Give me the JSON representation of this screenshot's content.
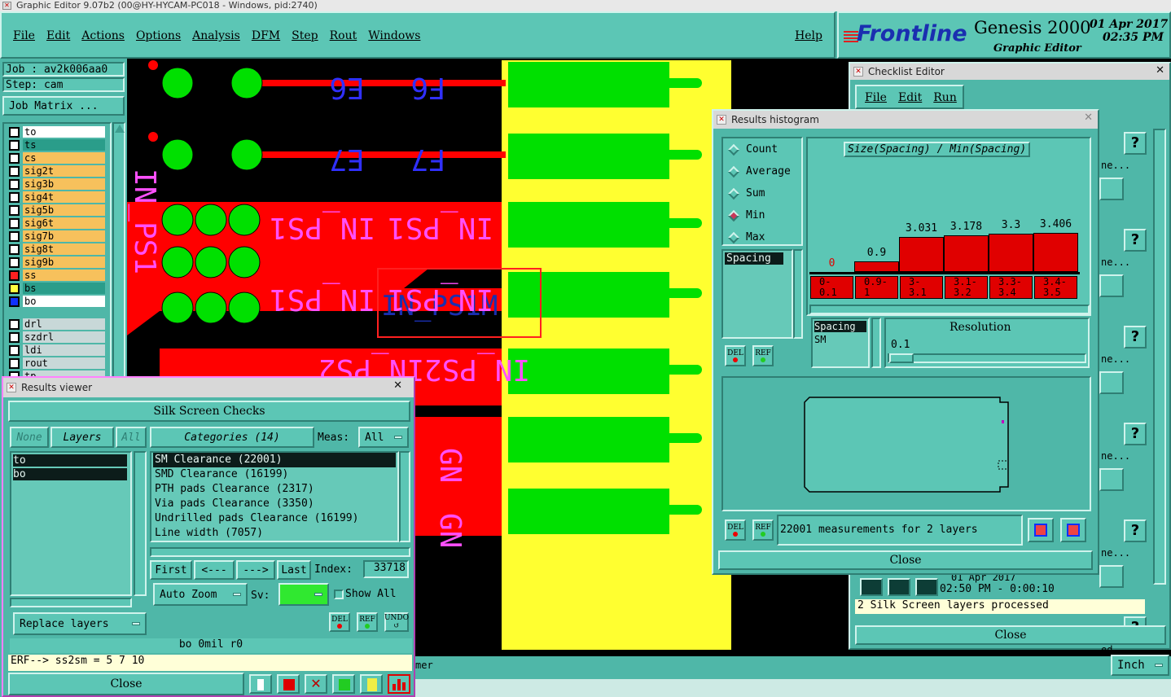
{
  "window": {
    "title": "Graphic Editor 9.07b2 (00@HY-HYCAM-PC018 - Windows, pid:2740)"
  },
  "menu": [
    "File",
    "Edit",
    "Actions",
    "Options",
    "Analysis",
    "DFM",
    "Step",
    "Rout",
    "Windows"
  ],
  "help": "Help",
  "brand": {
    "logo": "Frontline",
    "product": "Genesis 2000",
    "subtitle": "Graphic Editor",
    "date": "01 Apr 2017",
    "time": "02:35 PM"
  },
  "job": {
    "job_label": "Job : av2k006aa0",
    "step_label": "Step: cam",
    "matrix_button": "Job Matrix ..."
  },
  "layers": [
    {
      "name": "to",
      "color": "#ffffff",
      "box": "#ffffff"
    },
    {
      "name": "ts",
      "color": "#2a9d8a",
      "box": "#ffffff"
    },
    {
      "name": "cs",
      "color": "#f7c15c",
      "box": "#ffffff"
    },
    {
      "name": "sig2t",
      "color": "#f7c15c",
      "box": "#ffffff"
    },
    {
      "name": "sig3b",
      "color": "#f7c15c",
      "box": "#ffffff"
    },
    {
      "name": "sig4t",
      "color": "#f7c15c",
      "box": "#ffffff"
    },
    {
      "name": "sig5b",
      "color": "#f7c15c",
      "box": "#ffffff"
    },
    {
      "name": "sig6t",
      "color": "#f7c15c",
      "box": "#ffffff"
    },
    {
      "name": "sig7b",
      "color": "#f7c15c",
      "box": "#ffffff"
    },
    {
      "name": "sig8t",
      "color": "#f7c15c",
      "box": "#ffffff"
    },
    {
      "name": "sig9b",
      "color": "#f7c15c",
      "box": "#ffffff"
    },
    {
      "name": "ss",
      "color": "#f7c15c",
      "box": "#ff2020"
    },
    {
      "name": "bs",
      "color": "#2a9d8a",
      "box": "#ffff40"
    },
    {
      "name": "bo",
      "color": "#ffffff",
      "box": "#1030ff"
    }
  ],
  "layers2": [
    {
      "name": "drl",
      "color": "#c8d8d8"
    },
    {
      "name": "szdrl",
      "color": "#c8d8d8"
    },
    {
      "name": "ldi",
      "color": "#c8d8d8"
    },
    {
      "name": "rout",
      "color": "#c8d8d8"
    },
    {
      "name": "tp",
      "color": "#c8d8d8"
    }
  ],
  "board": {
    "labels_top": [
      "E6",
      "F6",
      "E7",
      "F7"
    ],
    "labels_net": [
      "IN_PS1",
      "IN_PS1",
      "IN_PS1",
      "IN_PS1",
      "IN_PS1",
      "IN_PS1M",
      "IN_PS2",
      "IN_PS2",
      "GN",
      "GN"
    ]
  },
  "results_viewer": {
    "title": "Results viewer",
    "header": "Silk Screen Checks",
    "none": "None",
    "layers": "Layers",
    "all": "All",
    "categories_btn": "Categories (14)",
    "meas_label": "Meas:",
    "meas_value": "All",
    "layer_list": [
      "to",
      "bo"
    ],
    "categories": [
      "SM Clearance (22001)",
      "SMD Clearance (16199)",
      "PTH pads Clearance (2317)",
      "Via pads Clearance (3350)",
      "Undrilled pads Clearance (16199)",
      "Line width (7057)"
    ],
    "first": "First",
    "prev": "<---",
    "next": "--->",
    "last": "Last",
    "index_label": "Index:",
    "index_value": "33718",
    "auto_zoom": "Auto Zoom",
    "sv_label": "Sv:",
    "show_all": "Show All",
    "replace_layers": "Replace layers",
    "status": "bo 0mil r0",
    "erf": "ERF--> ss2sm = 5 7 10",
    "close": "Close",
    "del": "DEL",
    "ref": "REF",
    "undo": "UNDO"
  },
  "histogram": {
    "title": "Results histogram",
    "modes": [
      "Count",
      "Average",
      "Sum",
      "Min",
      "Max"
    ],
    "selected_mode": "Min",
    "attr_list": [
      "Spacing"
    ],
    "chart_title": "Size(Spacing) / Min(Spacing)",
    "bins": [
      {
        "label": "0-\n0.1",
        "value": 0,
        "text": "0"
      },
      {
        "label": "0.9-\n1",
        "value": 0.9,
        "text": "0.9"
      },
      {
        "label": "3-\n3.1",
        "value": 3.031,
        "text": "3.031"
      },
      {
        "label": "3.1-\n3.2",
        "value": 3.178,
        "text": "3.178"
      },
      {
        "label": "3.3-\n3.4",
        "value": 3.3,
        "text": "3.3"
      },
      {
        "label": "3.4-\n3.5",
        "value": 3.406,
        "text": "3.406"
      }
    ],
    "list2": [
      "Spacing",
      "SM"
    ],
    "resolution_label": "Resolution",
    "resolution_value": "0.1",
    "measurements": "22001 measurements for 2 layers",
    "close": "Close",
    "del": "DEL",
    "ref": "REF"
  },
  "checklist": {
    "title": "Checklist Editor",
    "menu": [
      "File",
      "Edit",
      "Run"
    ],
    "date_line": "01 Apr 2017",
    "time_line": "02:50 PM - 0:00:10",
    "processed": "2 Silk Screen layers processed",
    "close": "Close",
    "side_text": [
      "ne...",
      "ne...",
      "ne...",
      "ne...",
      "ne...",
      "ed"
    ]
  },
  "bottom": {
    "unit": "Inch",
    "partial_text": "mer"
  },
  "colors": {
    "panel": "#4fb7a8",
    "button": "#5cc6b5",
    "copper": "#ff0000",
    "pad": "#00e000",
    "silk": "#3030ff",
    "solder": "#ffff30"
  }
}
